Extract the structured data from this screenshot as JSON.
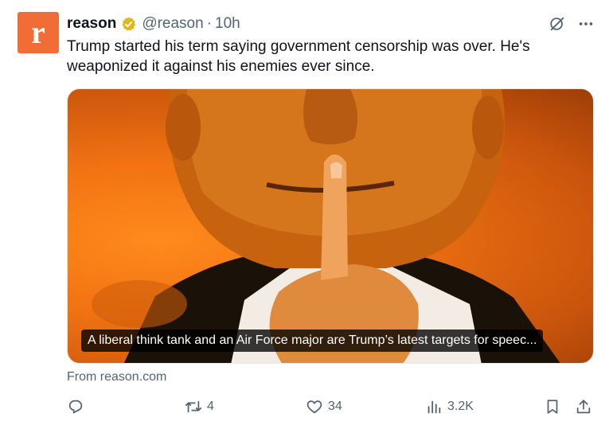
{
  "author": {
    "avatar_letter": "r",
    "name": "reason",
    "handle": "@reason",
    "separator": "·",
    "time": "10h",
    "verified_badge": "gold-check-icon"
  },
  "tweet": {
    "text": "Trump started his term saying government censorship was over. He's weaponized it against his enemies ever since."
  },
  "card": {
    "title": "A liberal think tank and an Air Force major are Trump’s latest targets for speec...",
    "source": "From reason.com"
  },
  "actions": {
    "reply": {
      "icon": "reply-icon",
      "count": ""
    },
    "retweet": {
      "icon": "retweet-icon",
      "count": "4"
    },
    "like": {
      "icon": "heart-icon",
      "count": "34"
    },
    "views": {
      "icon": "views-icon",
      "count": "3.2K"
    },
    "bookmark": {
      "icon": "bookmark-icon"
    },
    "share": {
      "icon": "share-icon"
    }
  },
  "colors": {
    "avatar_bg": "#f26d36",
    "verified_gold": "#e2b719",
    "muted_text": "#536471",
    "image_orange": "#f17312"
  }
}
